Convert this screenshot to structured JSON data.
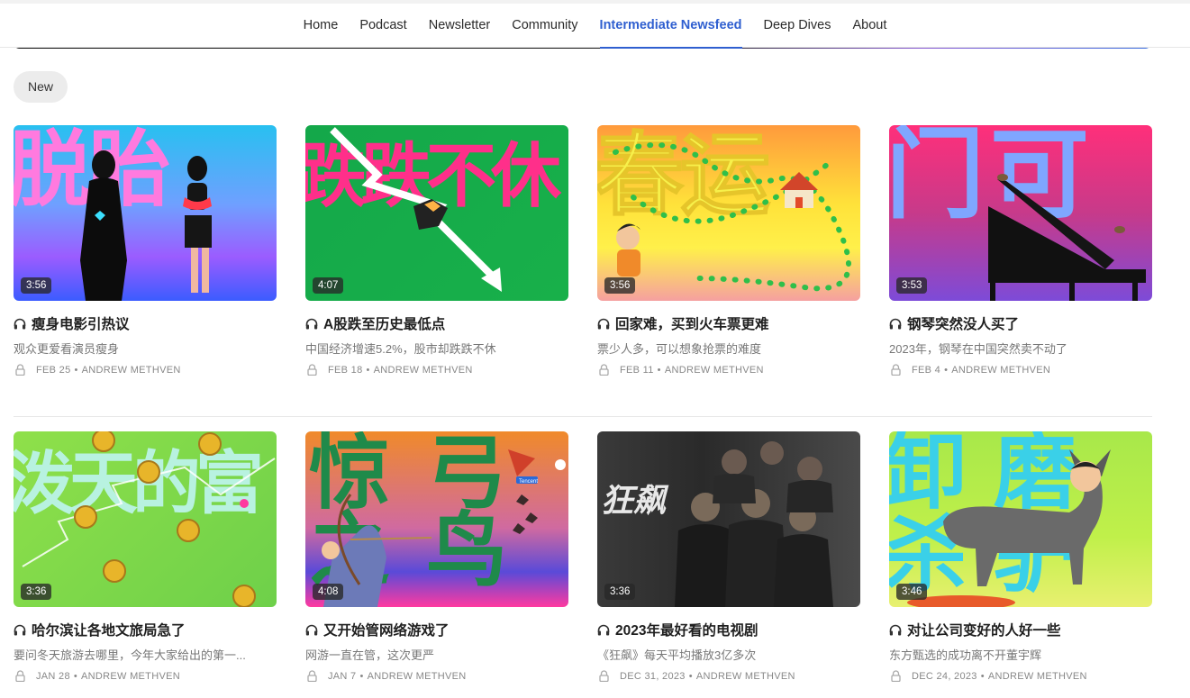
{
  "nav": {
    "items": [
      {
        "label": "Home"
      },
      {
        "label": "Podcast"
      },
      {
        "label": "Newsletter"
      },
      {
        "label": "Community"
      },
      {
        "label": "Intermediate Newsfeed",
        "active": true
      },
      {
        "label": "Deep Dives"
      },
      {
        "label": "About"
      }
    ],
    "accent": "#2f5fd0"
  },
  "filter": {
    "label": "New"
  },
  "icons": {
    "title": "headphones-icon",
    "meta": "lock-icon"
  },
  "posts": [
    {
      "duration": "3:56",
      "title": "瘦身电影引热议",
      "subtitle": "观众更爱看演员瘦身",
      "date": "FEB 25",
      "author": "ANDREW METHVEN"
    },
    {
      "duration": "4:07",
      "title": "A股跌至历史最低点",
      "subtitle": "中国经济增速5.2%，股市却跌跌不休",
      "date": "FEB 18",
      "author": "ANDREW METHVEN"
    },
    {
      "duration": "3:56",
      "title": "回家难，买到火车票更难",
      "subtitle": "票少人多，可以想象抢票的难度",
      "date": "FEB 11",
      "author": "ANDREW METHVEN"
    },
    {
      "duration": "3:53",
      "title": "钢琴突然没人买了",
      "subtitle": "2023年，钢琴在中国突然卖不动了",
      "date": "FEB 4",
      "author": "ANDREW METHVEN"
    },
    {
      "duration": "3:36",
      "title": "哈尔滨让各地文旅局急了",
      "subtitle": "要问冬天旅游去哪里，今年大家给出的第一...",
      "date": "JAN 28",
      "author": "ANDREW METHVEN"
    },
    {
      "duration": "4:08",
      "title": "又开始管网络游戏了",
      "subtitle": "网游一直在管，这次更严",
      "date": "JAN 7",
      "author": "ANDREW METHVEN"
    },
    {
      "duration": "3:36",
      "title": "2023年最好看的电视剧",
      "subtitle": "《狂飙》每天平均播放3亿多次",
      "date": "DEC 31, 2023",
      "author": "ANDREW METHVEN"
    },
    {
      "duration": "3:46",
      "title": "对让公司变好的人好一些",
      "subtitle": "东方甄选的成功离不开董宇辉",
      "date": "DEC 24, 2023",
      "author": "ANDREW METHVEN"
    }
  ],
  "thumb_text": {
    "p0": "脱胎",
    "p1": "跌跌不休",
    "p2": "春运",
    "p3": "门可",
    "p4": "泼天的富",
    "p5": "惊弓之鸟",
    "p6": "狂飙",
    "p7": "卸磨杀驴",
    "p5_badge": "Tencent"
  }
}
